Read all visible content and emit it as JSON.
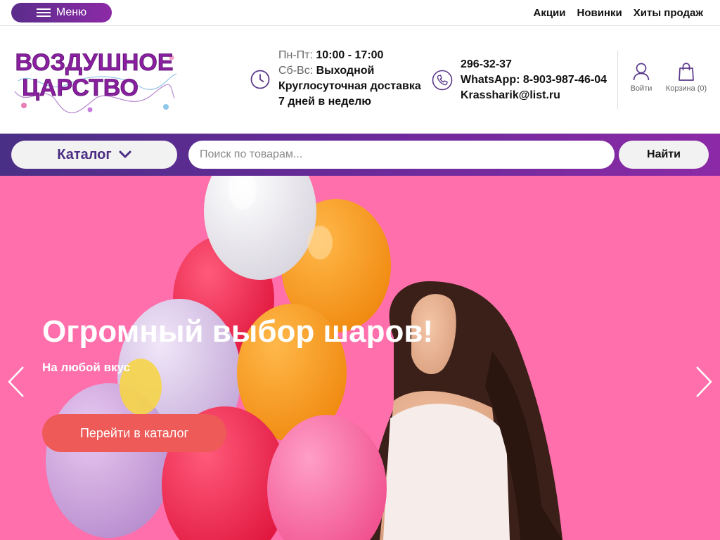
{
  "topbar": {
    "menu_label": "Меню",
    "links": [
      "Акции",
      "Новинки",
      "Хиты продаж"
    ]
  },
  "logo": {
    "line1": "ВОЗДУШНОЕ",
    "line2": "ЦАРСТВО"
  },
  "hours": {
    "weekday_label": "Пн-Пт:",
    "weekday_value": "10:00 - 17:00",
    "weekend_label": "Сб-Вс:",
    "weekend_value": "Выходной",
    "delivery_line1": "Круглосуточная доставка",
    "delivery_line2": "7 дней в неделю"
  },
  "contacts": {
    "phone": "296-32-37",
    "whatsapp": "WhatsApp: 8-903-987-46-04",
    "email": "Krassharik@list.ru"
  },
  "account": {
    "login_label": "Войти",
    "cart_label": "Корзина (0)"
  },
  "search": {
    "catalog_label": "Каталог",
    "placeholder": "Поиск по товарам...",
    "button_label": "Найти"
  },
  "hero": {
    "title": "Огромный выбор шаров!",
    "subtitle": "На любой вкус",
    "button_label": "Перейти в каталог"
  },
  "colors": {
    "brand_purple": "#6a2a9a",
    "hero_bg": "#ff68a7",
    "hero_button": "#ee5a57"
  },
  "icons": [
    "hamburger-icon",
    "clock-icon",
    "phone-icon",
    "user-icon",
    "cart-icon",
    "chevron-down-icon",
    "chevron-left-icon",
    "chevron-right-icon"
  ]
}
